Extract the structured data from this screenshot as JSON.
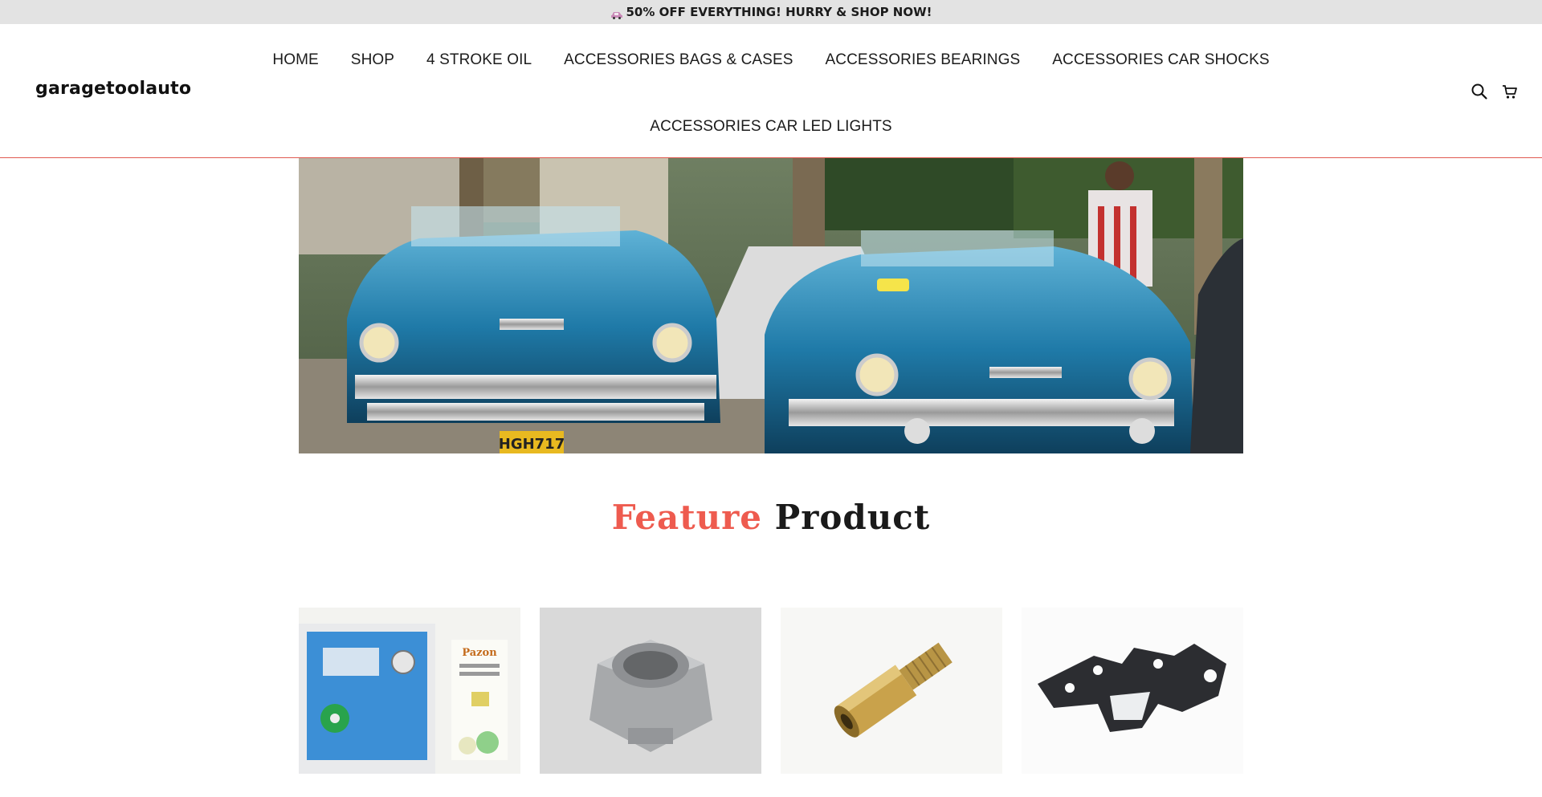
{
  "announcement": {
    "text": "50% OFF EVERYTHING! HURRY & SHOP NOW!",
    "icon": "car-emoji-icon"
  },
  "header": {
    "logo": "garagetoolauto",
    "nav_row1": [
      "HOME",
      "SHOP",
      "4 STROKE OIL",
      "ACCESSORIES BAGS & CASES",
      "ACCESSORIES BEARINGS",
      "ACCESSORIES CAR SHOCKS"
    ],
    "nav_row2": [
      "ACCESSORIES CAR LED LIGHTS"
    ],
    "icons": [
      "search-icon",
      "cart-icon"
    ]
  },
  "colors": {
    "accent": "#ee5b4f",
    "announcement_bg": "#e3e3e3",
    "header_border": "#e05a50"
  },
  "hero": {
    "alt": "two vintage blue cars"
  },
  "featured": {
    "title_accent": "Feature",
    "title_rest": "Product",
    "products": [
      {
        "image": "ignition-kit-box"
      },
      {
        "image": "steel-hex-nut"
      },
      {
        "image": "brass-hex-fitting"
      },
      {
        "image": "black-metal-bracket"
      }
    ]
  }
}
